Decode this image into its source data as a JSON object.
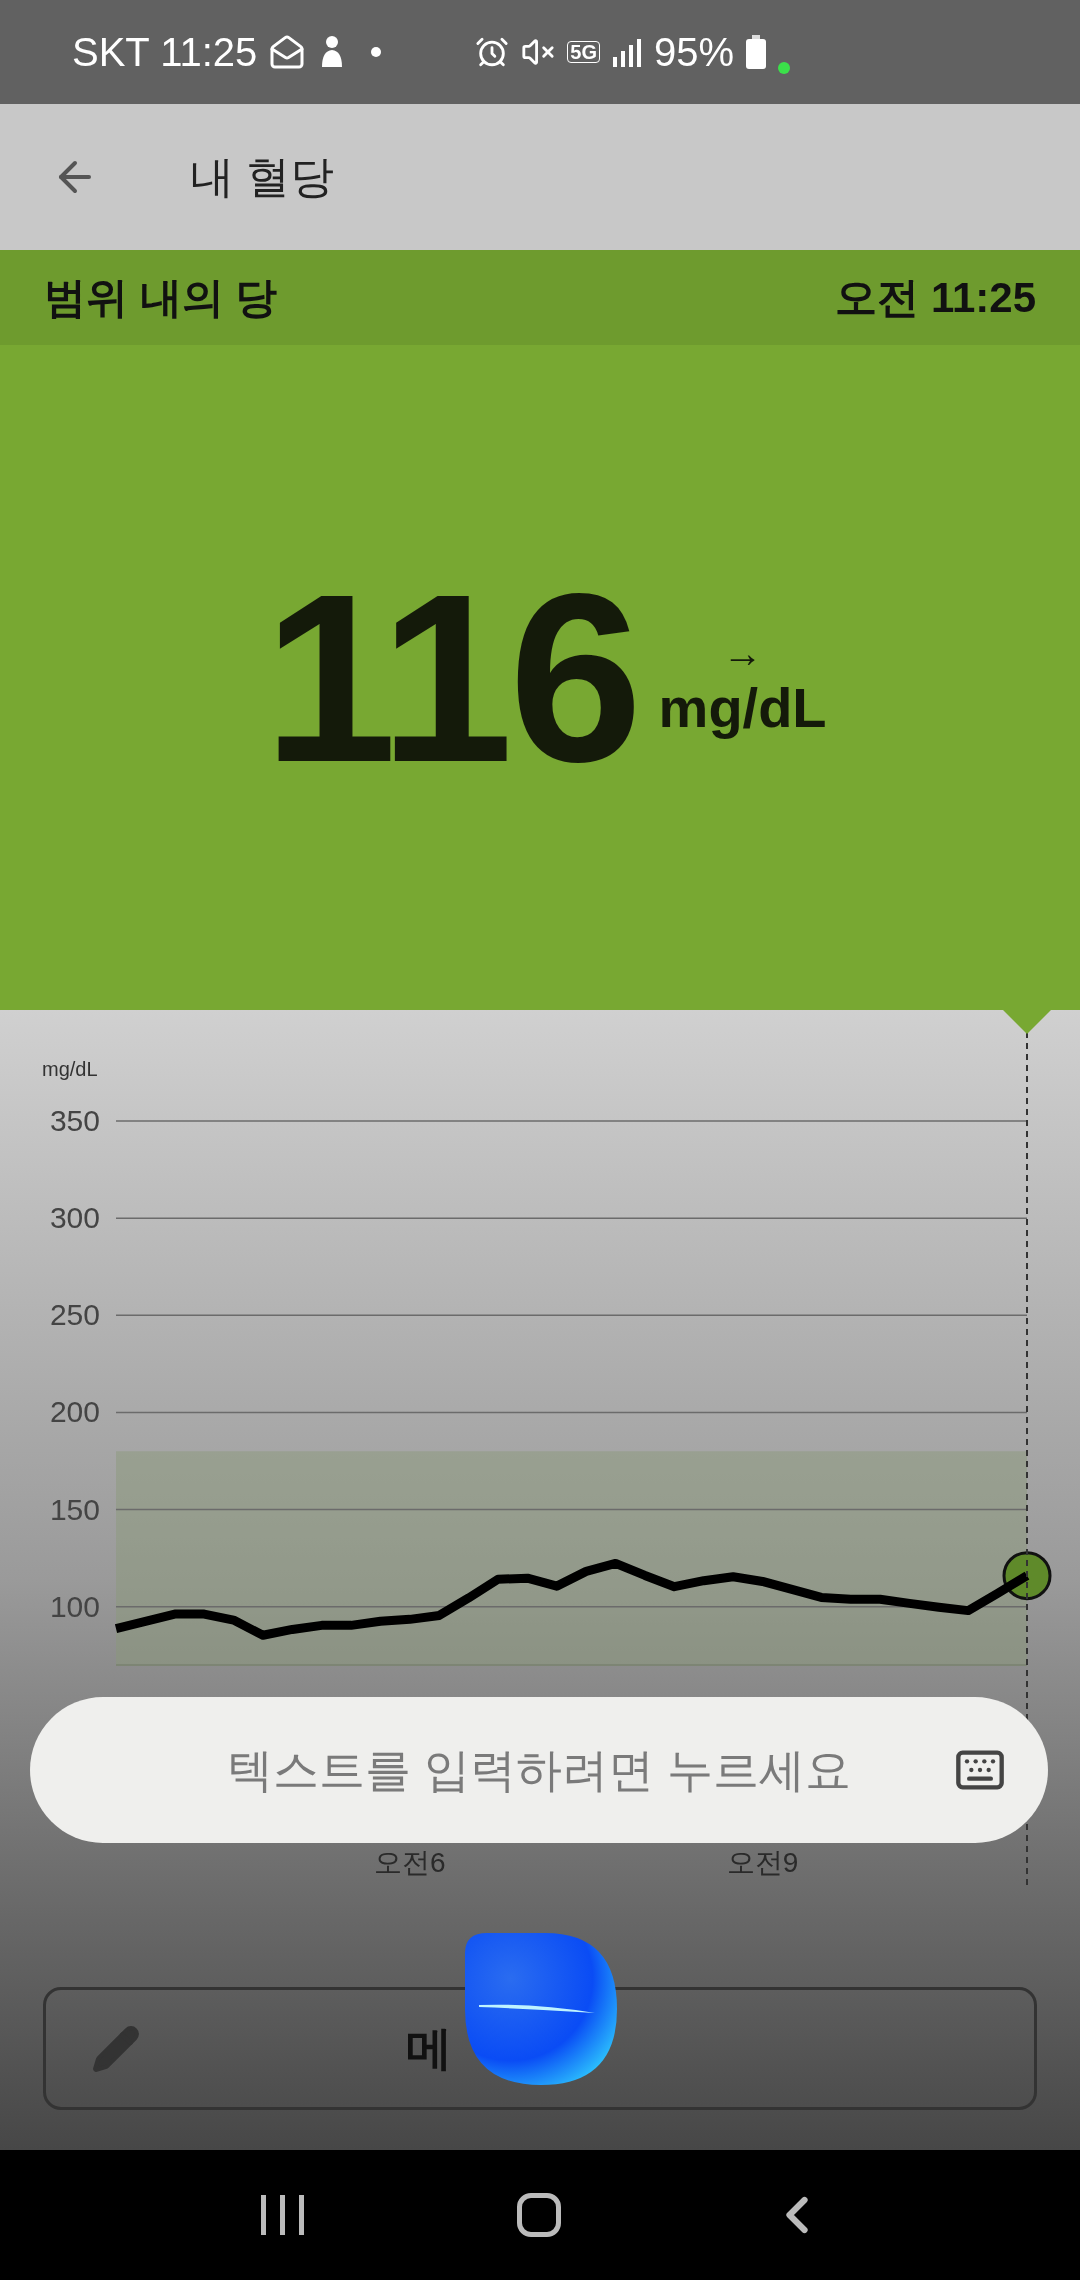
{
  "status_bar": {
    "carrier": "SKT",
    "time": "11:25",
    "network": "5G",
    "battery": "95%"
  },
  "app_bar": {
    "title": "내 혈당"
  },
  "status_strip": {
    "label": "범위 내의 당",
    "time": "오전 11:25"
  },
  "reading": {
    "value": "116",
    "trend": "→",
    "unit": "mg/dL"
  },
  "chart": {
    "unit_label": "mg/dL",
    "chart_data": {
      "type": "line",
      "categories": [
        null,
        null,
        null,
        null,
        null,
        null,
        null,
        null,
        null,
        null,
        "오전6",
        null,
        null,
        null,
        null,
        null,
        null,
        null,
        null,
        null,
        null,
        null,
        "오전9",
        null,
        null,
        null,
        null,
        null,
        null,
        null,
        null,
        null
      ],
      "series": [
        {
          "color": "#000000",
          "values": [
            88.7,
            92.5,
            96.2,
            96.2,
            93.1,
            85.3,
            88.3,
            90.4,
            90.4,
            92.5,
            93.5,
            95.5,
            104.5,
            114.1,
            114.7,
            110.6,
            118.2,
            122.3,
            116.1,
            110.3,
            113.4,
            115.4,
            113.0,
            108.9,
            104.8,
            103.8,
            103.8,
            101.7,
            99.7,
            98.0,
            106.9,
            116
          ]
        }
      ],
      "ylim": [
        70,
        350
      ],
      "grid": true,
      "yticks": [
        {
          "value": 100,
          "label": "100"
        },
        {
          "value": 150,
          "label": "150"
        },
        {
          "value": 200,
          "label": "200"
        },
        {
          "value": 250,
          "label": "250"
        },
        {
          "value": 300,
          "label": "300"
        },
        {
          "value": 350,
          "label": "350"
        }
      ]
    }
  },
  "text_input": {
    "placeholder": "텍스트를 입력하려면 누르세요"
  },
  "note_button": {
    "label": "메"
  }
}
